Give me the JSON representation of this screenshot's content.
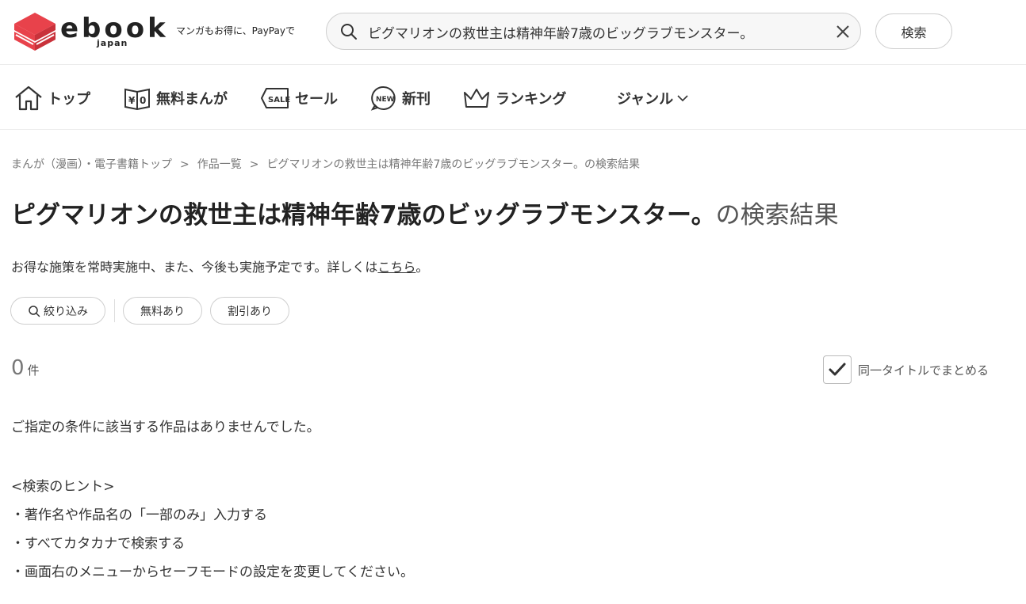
{
  "header": {
    "logo_word": "ebook",
    "logo_sub": "japan",
    "tagline": "マンガもお得に、PayPayで",
    "search_value": "ピグマリオンの救世主は精神年齢7歳のビッグラブモンスター。",
    "search_button": "検索"
  },
  "nav": {
    "items": [
      {
        "label": "トップ",
        "icon": "home-icon"
      },
      {
        "label": "無料まんが",
        "icon": "free-book-icon"
      },
      {
        "label": "セール",
        "icon": "sale-tag-icon"
      },
      {
        "label": "新刊",
        "icon": "new-badge-icon"
      },
      {
        "label": "ランキング",
        "icon": "crown-icon"
      },
      {
        "label": "ジャンル",
        "icon": "chevron-down-icon"
      }
    ]
  },
  "breadcrumb": {
    "items": [
      "まんが（漫画）・電子書籍トップ",
      "作品一覧",
      "ピグマリオンの救世主は精神年齢7歳のビッグラブモンスター。の検索結果"
    ],
    "separator": ">"
  },
  "title": {
    "query": "ピグマリオンの救世主は精神年齢7歳のビッグラブモンスター。",
    "suffix": "の検索結果"
  },
  "notice": {
    "text": "お得な施策を常時実施中、また、今後も実施予定です。詳しくは",
    "link": "こちら",
    "end": "。"
  },
  "filters": {
    "narrow": "絞り込み",
    "free": "無料あり",
    "discount": "割引あり"
  },
  "results": {
    "count": "0",
    "unit": "件",
    "group_label": "同一タイトルでまとめる",
    "group_checked": true,
    "empty_message": "ご指定の条件に該当する作品はありませんでした。",
    "hints_title": "<検索のヒント>",
    "hints": [
      "・著作名や作品名の「一部のみ」入力する",
      "・すべてカタカナで検索する",
      "・画面右のメニューからセーフモードの設定を変更してください。"
    ]
  },
  "colors": {
    "logo_red": "#e8424b",
    "text": "#333333",
    "muted": "#777777",
    "border": "#cfcfcf"
  }
}
